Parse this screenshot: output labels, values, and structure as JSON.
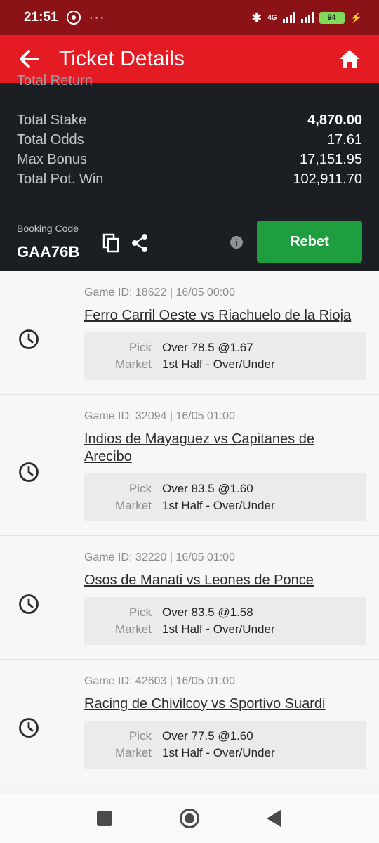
{
  "status_bar": {
    "time": "21:51",
    "network": "4G",
    "battery": "94"
  },
  "app_bar": {
    "title": "Ticket Details"
  },
  "summary": {
    "cut_label": "Total Return",
    "rows": [
      {
        "label": "Total Stake",
        "value": "4,870.00"
      },
      {
        "label": "Total Odds",
        "value": "17.61"
      },
      {
        "label": "Max Bonus",
        "value": "17,151.95"
      },
      {
        "label": "Total Pot. Win",
        "value": "102,911.70"
      }
    ],
    "booking_label": "Booking Code",
    "booking_code": "GAA76B",
    "info_glyph": "i",
    "rebet_label": "Rebet"
  },
  "bets": [
    {
      "meta": "Game ID: 18622 | 16/05 00:00",
      "match": "Ferro Carril Oeste vs Riachuelo de la Rioja",
      "pick_label": "Pick",
      "pick": "Over 78.5 @1.67",
      "market_label": "Market",
      "market": "1st Half - Over/Under"
    },
    {
      "meta": "Game ID: 32094 | 16/05 01:00",
      "match": "Indios de Mayaguez vs Capitanes de Arecibo",
      "pick_label": "Pick",
      "pick": "Over 83.5 @1.60",
      "market_label": "Market",
      "market": "1st Half - Over/Under"
    },
    {
      "meta": "Game ID: 32220 | 16/05 01:00",
      "match": "Osos de Manati vs Leones de Ponce",
      "pick_label": "Pick",
      "pick": "Over 83.5 @1.58",
      "market_label": "Market",
      "market": "1st Half - Over/Under"
    },
    {
      "meta": "Game ID: 42603 | 16/05 01:00",
      "match": "Racing de Chivilcoy vs Sportivo Suardi",
      "pick_label": "Pick",
      "pick": "Over 77.5 @1.60",
      "market_label": "Market",
      "market": "1st Half - Over/Under"
    }
  ],
  "colors": {
    "brand_red": "#e41b23",
    "status_red": "#8b1217",
    "panel_dark": "#1b1f24",
    "rebet_green": "#1e9e3e"
  },
  "icons": [
    "whatsapp-icon",
    "bluetooth-icon",
    "signal-icon",
    "battery-icon",
    "back-arrow-icon",
    "home-icon",
    "copy-icon",
    "share-icon",
    "info-icon",
    "clock-icon",
    "recents-icon",
    "home-circle-icon",
    "back-triangle-icon"
  ]
}
